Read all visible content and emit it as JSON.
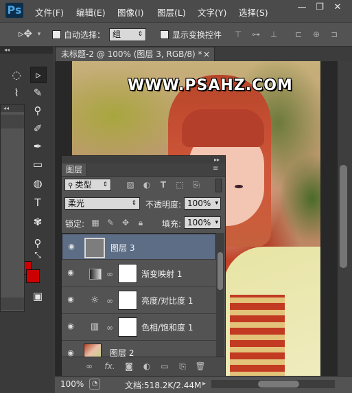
{
  "app": {
    "logo": "Ps"
  },
  "menu": [
    "文件(F)",
    "编辑(E)",
    "图像(I)",
    "图层(L)",
    "文字(Y)",
    "选择(S)"
  ],
  "window_controls": {
    "minimize": "—",
    "restore": "❐",
    "close": "✕"
  },
  "options": {
    "auto_select_label": "自动选择：",
    "auto_select_value": "组",
    "transform_label": "显示变换控件"
  },
  "document": {
    "tab_title": "未标题-2 @ 100% (图层 3, RGB/8) *",
    "close": "×",
    "watermark": "WWW.PSAHZ.COM",
    "zoom": "100%",
    "doc_info": "文档:518.2K/2.44M"
  },
  "tools": [
    "marquee-icon",
    "move-icon",
    "lasso-icon",
    "brush-icon",
    "eyedropper-icon",
    "brush-icon",
    "stamp-icon",
    "gradient-icon",
    "magnifier-icon",
    "type-icon",
    "shape-icon",
    "zoom-icon",
    "rotate-icon"
  ],
  "colors": {
    "foreground": "#cc0000",
    "accent_selected": "#5d6d86",
    "background": "#3c3c3c"
  },
  "layers_panel": {
    "title": "图层",
    "filter_kind": "类型",
    "blend_mode": "柔光",
    "opacity_label": "不透明度:",
    "opacity_value": "100%",
    "lock_label": "锁定:",
    "fill_label": "填充:",
    "fill_value": "100%",
    "layers": [
      {
        "name": "图层 3",
        "selected": true,
        "type": "pixel"
      },
      {
        "name": "渐变映射 1",
        "selected": false,
        "type": "gradient-map"
      },
      {
        "name": "亮度/对比度 1",
        "selected": false,
        "type": "brightness-contrast"
      },
      {
        "name": "色相/饱和度 1",
        "selected": false,
        "type": "hue-saturation"
      },
      {
        "name": "图层 2",
        "selected": false,
        "type": "pixel"
      }
    ]
  }
}
